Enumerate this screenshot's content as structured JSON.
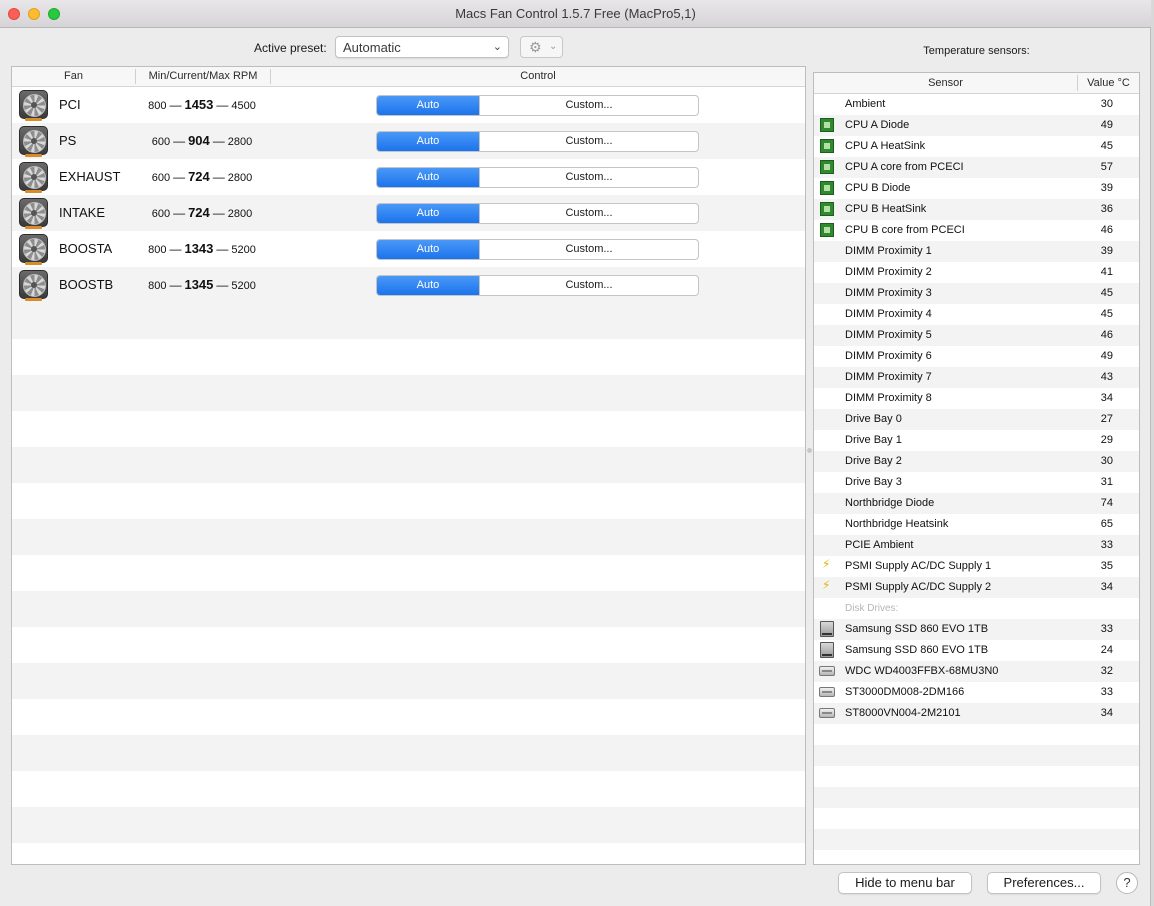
{
  "window": {
    "title": "Macs Fan Control 1.5.7 Free (MacPro5,1)"
  },
  "preset": {
    "label": "Active preset:",
    "value": "Automatic",
    "chevron_icon": "chevron-down-icon",
    "gear_icon": "gear-icon"
  },
  "fan_table": {
    "headers": {
      "fan": "Fan",
      "rpm": "Min/Current/Max RPM",
      "control": "Control"
    },
    "rows": [
      {
        "name": "PCI",
        "min": "800",
        "current": "1453",
        "max": "4500",
        "auto": "Auto",
        "custom": "Custom..."
      },
      {
        "name": "PS",
        "min": "600",
        "current": "904",
        "max": "2800",
        "auto": "Auto",
        "custom": "Custom..."
      },
      {
        "name": "EXHAUST",
        "min": "600",
        "current": "724",
        "max": "2800",
        "auto": "Auto",
        "custom": "Custom..."
      },
      {
        "name": "INTAKE",
        "min": "600",
        "current": "724",
        "max": "2800",
        "auto": "Auto",
        "custom": "Custom..."
      },
      {
        "name": "BOOSTA",
        "min": "800",
        "current": "1343",
        "max": "5200",
        "auto": "Auto",
        "custom": "Custom..."
      },
      {
        "name": "BOOSTB",
        "min": "800",
        "current": "1345",
        "max": "5200",
        "auto": "Auto",
        "custom": "Custom..."
      }
    ],
    "dash": "—"
  },
  "sensors": {
    "title": "Temperature sensors:",
    "headers": {
      "sensor": "Sensor",
      "value": "Value °C"
    },
    "rows": [
      {
        "name": "Ambient",
        "value": "30",
        "icon": ""
      },
      {
        "name": "CPU A Diode",
        "value": "49",
        "icon": "cpu-chip-icon"
      },
      {
        "name": "CPU A HeatSink",
        "value": "45",
        "icon": "cpu-chip-icon"
      },
      {
        "name": "CPU A core from PCECI",
        "value": "57",
        "icon": "cpu-chip-icon"
      },
      {
        "name": "CPU B Diode",
        "value": "39",
        "icon": "cpu-chip-icon"
      },
      {
        "name": "CPU B HeatSink",
        "value": "36",
        "icon": "cpu-chip-icon"
      },
      {
        "name": "CPU B core from PCECI",
        "value": "46",
        "icon": "cpu-chip-icon"
      },
      {
        "name": "DIMM Proximity 1",
        "value": "39",
        "icon": ""
      },
      {
        "name": "DIMM Proximity 2",
        "value": "41",
        "icon": ""
      },
      {
        "name": "DIMM Proximity 3",
        "value": "45",
        "icon": ""
      },
      {
        "name": "DIMM Proximity 4",
        "value": "45",
        "icon": ""
      },
      {
        "name": "DIMM Proximity 5",
        "value": "46",
        "icon": ""
      },
      {
        "name": "DIMM Proximity 6",
        "value": "49",
        "icon": ""
      },
      {
        "name": "DIMM Proximity 7",
        "value": "43",
        "icon": ""
      },
      {
        "name": "DIMM Proximity 8",
        "value": "34",
        "icon": ""
      },
      {
        "name": "Drive Bay 0",
        "value": "27",
        "icon": ""
      },
      {
        "name": "Drive Bay 1",
        "value": "29",
        "icon": ""
      },
      {
        "name": "Drive Bay 2",
        "value": "30",
        "icon": ""
      },
      {
        "name": "Drive Bay 3",
        "value": "31",
        "icon": ""
      },
      {
        "name": "Northbridge Diode",
        "value": "74",
        "icon": ""
      },
      {
        "name": "Northbridge Heatsink",
        "value": "65",
        "icon": ""
      },
      {
        "name": "PCIE Ambient",
        "value": "33",
        "icon": ""
      },
      {
        "name": "PSMI Supply AC/DC Supply 1",
        "value": "35",
        "icon": "lightning-bolt-icon"
      },
      {
        "name": "PSMI Supply AC/DC Supply 2",
        "value": "34",
        "icon": "lightning-bolt-icon"
      }
    ],
    "disk_section": "Disk Drives:",
    "disks": [
      {
        "name": "Samsung SSD 860 EVO 1TB",
        "value": "33",
        "icon": "ssd-icon"
      },
      {
        "name": "Samsung SSD 860 EVO 1TB",
        "value": "24",
        "icon": "ssd-icon"
      },
      {
        "name": "WDC WD4003FFBX-68MU3N0",
        "value": "32",
        "icon": "hard-drive-icon"
      },
      {
        "name": "ST3000DM008-2DM166",
        "value": "33",
        "icon": "hard-drive-icon"
      },
      {
        "name": "ST8000VN004-2M2101",
        "value": "34",
        "icon": "hard-drive-icon"
      }
    ]
  },
  "footer": {
    "hide_label": "Hide to menu bar",
    "prefs_label": "Preferences...",
    "help_label": "?"
  },
  "colors": {
    "accent": "#1c74ec",
    "cpu_chip": "#2f8a2f",
    "bolt": "#e6b400"
  }
}
